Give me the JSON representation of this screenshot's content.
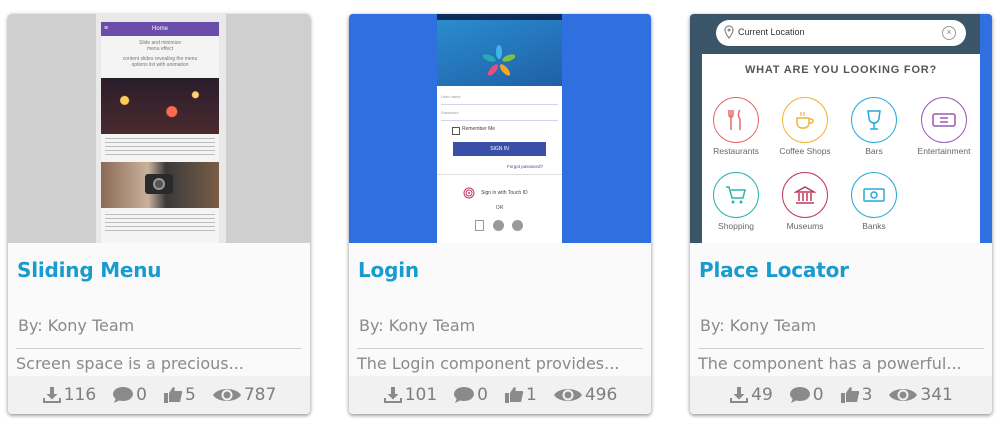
{
  "cards": [
    {
      "title": "Sliding Menu",
      "author": "By: Kony Team",
      "description": "Screen space is a precious...",
      "stats": {
        "downloads": "116",
        "comments": "0",
        "likes": "5",
        "views": "787"
      },
      "thumbnail": {
        "app_bar_title": "Home",
        "intro_line1": "Slide and minimize",
        "intro_line2": "menu effect",
        "intro_line3": "content slides revealing the menu",
        "intro_line4": "options list with animation"
      }
    },
    {
      "title": "Login",
      "author": "By: Kony Team",
      "description": "The Login component provides...",
      "stats": {
        "downloads": "101",
        "comments": "0",
        "likes": "1",
        "views": "496"
      },
      "thumbnail": {
        "username_placeholder": "User name",
        "password_placeholder": "Password",
        "remember_me": "Remember Me",
        "sign_in": "SIGN IN",
        "forgot_password": "Forgot password?",
        "touch_id": "Sign in with Touch ID",
        "or": "OR"
      }
    },
    {
      "title": "Place Locator",
      "author": "By: Kony Team",
      "description": "The component has a powerful...",
      "stats": {
        "downloads": "49",
        "comments": "0",
        "likes": "3",
        "views": "341"
      },
      "thumbnail": {
        "search_text": "Current Location",
        "heading": "WHAT ARE YOU LOOKING FOR?",
        "categories": [
          "Restaurants",
          "Coffee Shops",
          "Bars",
          "Entertainment",
          "Shopping",
          "Museums",
          "Banks"
        ],
        "category_colors": [
          "#e86a6a",
          "#f0b43a",
          "#29a9d8",
          "#9b59b6",
          "#2bb5a8",
          "#c0395a",
          "#29a9d8"
        ]
      }
    }
  ],
  "colors": {
    "title": "#1a9bd0",
    "meta": "#8a8a8a",
    "login_bg": "#2f6fe0"
  }
}
